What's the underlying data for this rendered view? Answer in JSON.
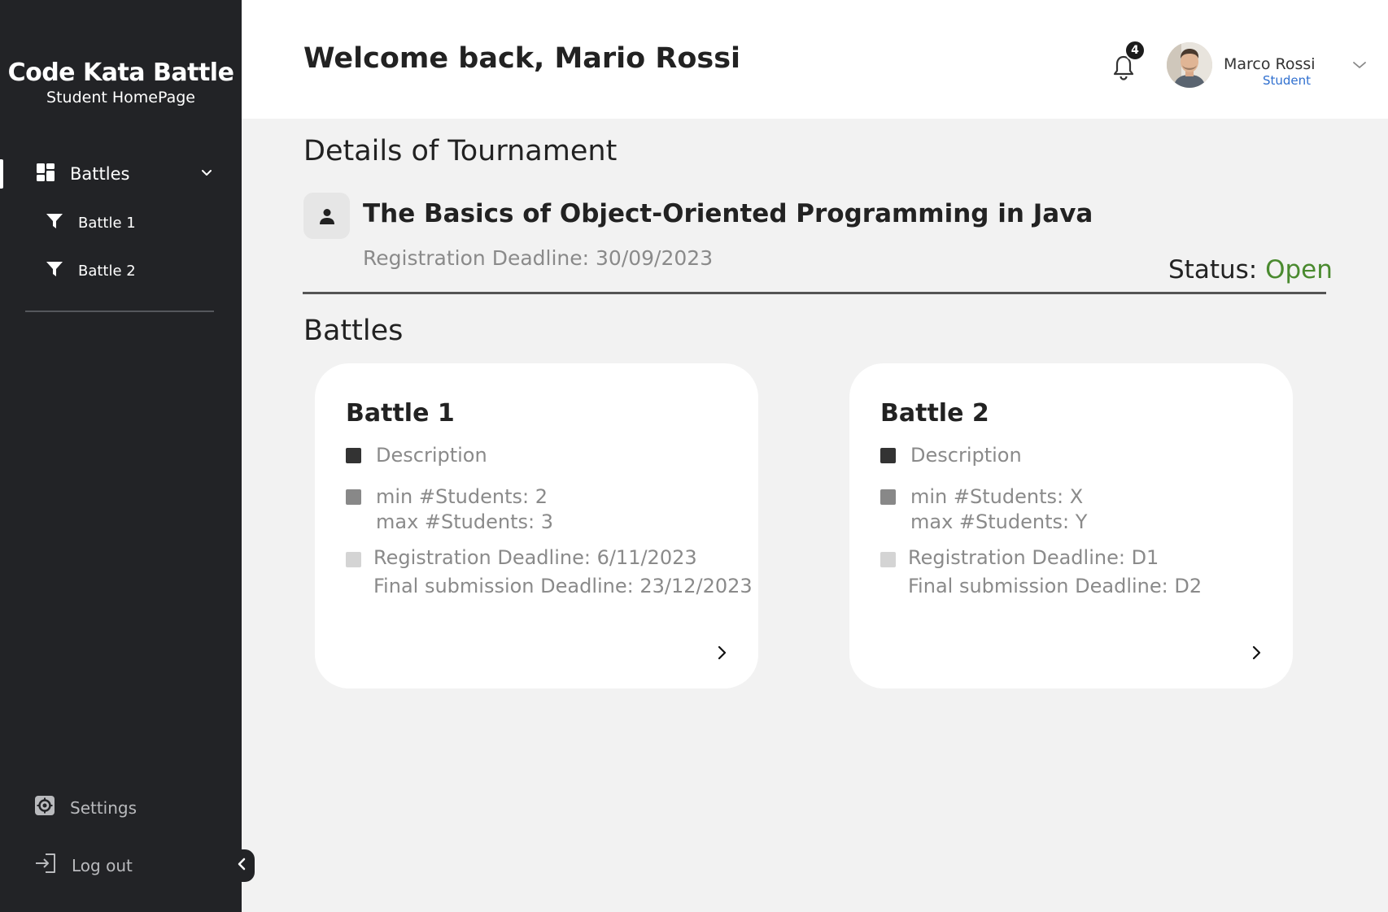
{
  "brand": {
    "title": "Code Kata Battle",
    "subtitle": "Student HomePage"
  },
  "sidebar": {
    "items": [
      {
        "label": "Battles",
        "icon": "dashboard-icon"
      },
      {
        "label": "Battle 1",
        "icon": "filter-icon"
      },
      {
        "label": "Battle 2",
        "icon": "filter-icon"
      }
    ],
    "settings_label": "Settings",
    "logout_label": "Log out"
  },
  "header": {
    "welcome": "Welcome back, Mario Rossi",
    "notification_count": "4",
    "user_name": "Marco Rossi",
    "user_role": "Student"
  },
  "tournament": {
    "section_title": "Details of Tournament",
    "name": "The Basics of Object-Oriented Programming in Java",
    "registration_deadline": "Registration Deadline: 30/09/2023",
    "status_label": "Status: ",
    "status_value": "Open"
  },
  "battles": {
    "section_title": "Battles",
    "cards": [
      {
        "title": "Battle 1",
        "description": "Description",
        "min_students": "min #Students: 2",
        "max_students": "max #Students: 3",
        "registration_deadline": "Registration Deadline: 6/11/2023",
        "final_deadline": "Final submission Deadline: 23/12/2023"
      },
      {
        "title": "Battle 2",
        "description": "Description",
        "min_students": "min #Students: X",
        "max_students": "max #Students: Y",
        "registration_deadline": "Registration Deadline: D1",
        "final_deadline": "Final submission Deadline: D2"
      }
    ]
  },
  "colors": {
    "sidebar_bg": "#222326",
    "status_open": "#4a8a2f",
    "role_blue": "#2f6fcf",
    "bullet_dark": "#333333",
    "bullet_mid": "#888888",
    "bullet_light": "#d4d4d4"
  }
}
